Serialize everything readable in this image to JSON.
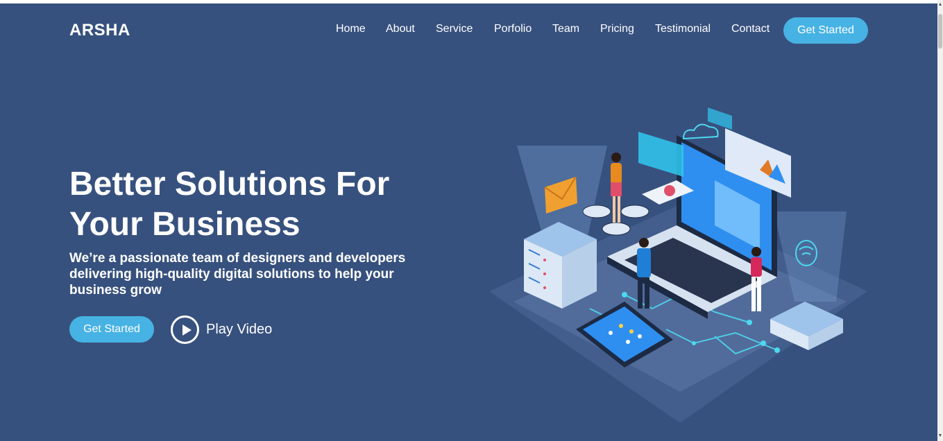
{
  "brand": {
    "logo": "ARSHA"
  },
  "nav": {
    "items": [
      {
        "label": "Home"
      },
      {
        "label": "About"
      },
      {
        "label": "Service"
      },
      {
        "label": "Porfolio"
      },
      {
        "label": "Team"
      },
      {
        "label": "Pricing"
      },
      {
        "label": "Testimonial"
      },
      {
        "label": "Contact"
      }
    ],
    "cta_label": "Get Started"
  },
  "hero": {
    "title": "Better Solutions For Your Business",
    "subtitle": "We’re a passionate team of designers and developers delivering high-quality digital solutions to help your business grow",
    "primary_button": "Get Started",
    "video_button": "Play Video"
  },
  "colors": {
    "background": "#37517e",
    "accent": "#47b2e4",
    "text": "#ffffff"
  },
  "icons": {
    "play": "play-circle-icon",
    "illustration": "tech-isometric-illustration"
  }
}
